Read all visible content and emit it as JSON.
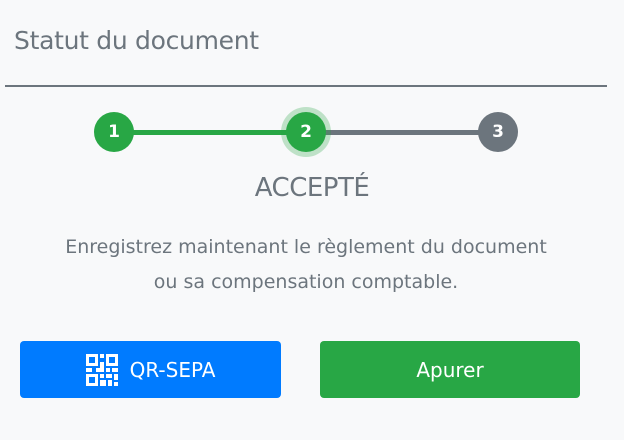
{
  "header": {
    "title": "Statut du document"
  },
  "stepper": {
    "steps": [
      {
        "number": "1",
        "state": "done"
      },
      {
        "number": "2",
        "state": "current"
      },
      {
        "number": "3",
        "state": "pending"
      }
    ],
    "colors": {
      "done": "#28a745",
      "pending": "#6c757d"
    }
  },
  "status": {
    "label": "ACCEPTÉ"
  },
  "message": {
    "line1": "Enregistrez maintenant le règlement du document",
    "line2": "ou sa compensation comptable."
  },
  "actions": {
    "qr_sepa": {
      "label": "QR-SEPA",
      "icon": "qr-code-icon",
      "color": "#007bff"
    },
    "apurer": {
      "label": "Apurer",
      "color": "#28a745"
    }
  }
}
